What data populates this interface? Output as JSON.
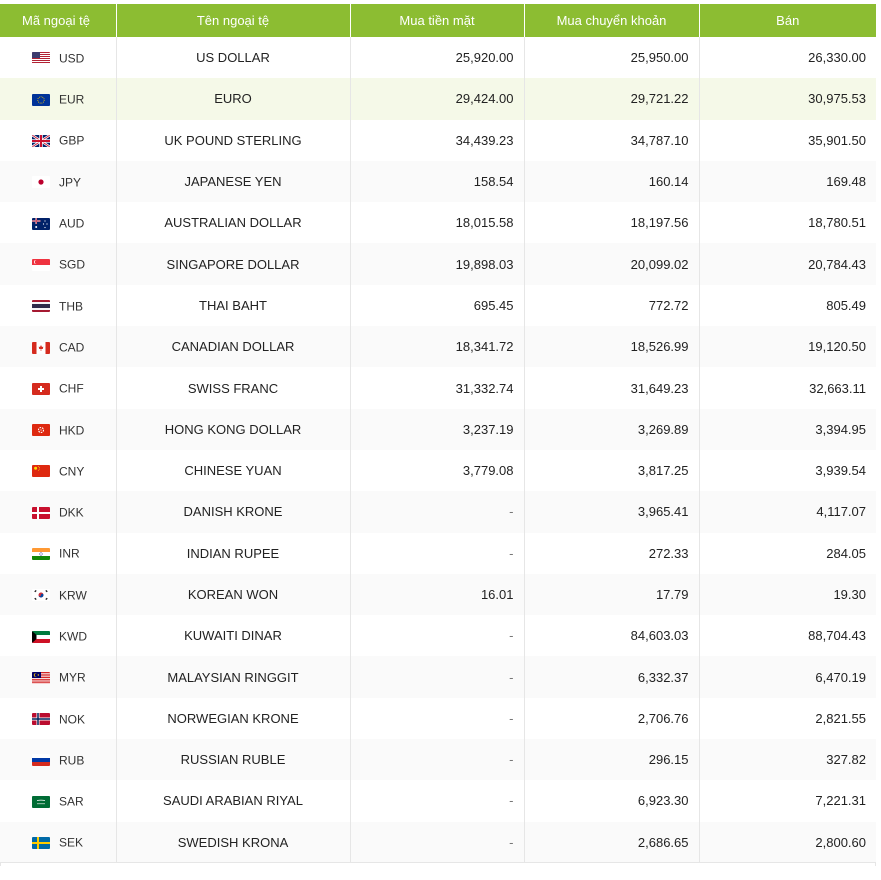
{
  "header": {
    "code": "Mã ngoại tệ",
    "name": "Tên ngoại tệ",
    "cash_buy": "Mua tiền mặt",
    "transfer_buy": "Mua chuyển khoản",
    "sell": "Bán"
  },
  "colors": {
    "header_bg": "#8cbd32",
    "highlight_row": "#f5f9e8"
  },
  "rows": [
    {
      "code": "USD",
      "name": "US DOLLAR",
      "cash": "25,920.00",
      "transfer": "25,950.00",
      "sell": "26,330.00",
      "flag": "us-flag-icon"
    },
    {
      "code": "EUR",
      "name": "EURO",
      "cash": "29,424.00",
      "transfer": "29,721.22",
      "sell": "30,975.53",
      "flag": "eu-flag-icon"
    },
    {
      "code": "GBP",
      "name": "UK POUND STERLING",
      "cash": "34,439.23",
      "transfer": "34,787.10",
      "sell": "35,901.50",
      "flag": "uk-flag-icon"
    },
    {
      "code": "JPY",
      "name": "JAPANESE YEN",
      "cash": "158.54",
      "transfer": "160.14",
      "sell": "169.48",
      "flag": "jp-flag-icon"
    },
    {
      "code": "AUD",
      "name": "AUSTRALIAN DOLLAR",
      "cash": "18,015.58",
      "transfer": "18,197.56",
      "sell": "18,780.51",
      "flag": "au-flag-icon"
    },
    {
      "code": "SGD",
      "name": "SINGAPORE DOLLAR",
      "cash": "19,898.03",
      "transfer": "20,099.02",
      "sell": "20,784.43",
      "flag": "sg-flag-icon"
    },
    {
      "code": "THB",
      "name": "THAI BAHT",
      "cash": "695.45",
      "transfer": "772.72",
      "sell": "805.49",
      "flag": "th-flag-icon"
    },
    {
      "code": "CAD",
      "name": "CANADIAN DOLLAR",
      "cash": "18,341.72",
      "transfer": "18,526.99",
      "sell": "19,120.50",
      "flag": "ca-flag-icon"
    },
    {
      "code": "CHF",
      "name": "SWISS FRANC",
      "cash": "31,332.74",
      "transfer": "31,649.23",
      "sell": "32,663.11",
      "flag": "ch-flag-icon"
    },
    {
      "code": "HKD",
      "name": "HONG KONG DOLLAR",
      "cash": "3,237.19",
      "transfer": "3,269.89",
      "sell": "3,394.95",
      "flag": "hk-flag-icon"
    },
    {
      "code": "CNY",
      "name": "CHINESE YUAN",
      "cash": "3,779.08",
      "transfer": "3,817.25",
      "sell": "3,939.54",
      "flag": "cn-flag-icon"
    },
    {
      "code": "DKK",
      "name": "DANISH KRONE",
      "cash": "-",
      "transfer": "3,965.41",
      "sell": "4,117.07",
      "flag": "dk-flag-icon"
    },
    {
      "code": "INR",
      "name": "INDIAN RUPEE",
      "cash": "-",
      "transfer": "272.33",
      "sell": "284.05",
      "flag": "in-flag-icon"
    },
    {
      "code": "KRW",
      "name": "KOREAN WON",
      "cash": "16.01",
      "transfer": "17.79",
      "sell": "19.30",
      "flag": "kr-flag-icon"
    },
    {
      "code": "KWD",
      "name": "KUWAITI DINAR",
      "cash": "-",
      "transfer": "84,603.03",
      "sell": "88,704.43",
      "flag": "kw-flag-icon"
    },
    {
      "code": "MYR",
      "name": "MALAYSIAN RINGGIT",
      "cash": "-",
      "transfer": "6,332.37",
      "sell": "6,470.19",
      "flag": "my-flag-icon"
    },
    {
      "code": "NOK",
      "name": "NORWEGIAN KRONE",
      "cash": "-",
      "transfer": "2,706.76",
      "sell": "2,821.55",
      "flag": "no-flag-icon"
    },
    {
      "code": "RUB",
      "name": "RUSSIAN RUBLE",
      "cash": "-",
      "transfer": "296.15",
      "sell": "327.82",
      "flag": "ru-flag-icon"
    },
    {
      "code": "SAR",
      "name": "SAUDI ARABIAN RIYAL",
      "cash": "-",
      "transfer": "6,923.30",
      "sell": "7,221.31",
      "flag": "sa-flag-icon"
    },
    {
      "code": "SEK",
      "name": "SWEDISH KRONA",
      "cash": "-",
      "transfer": "2,686.65",
      "sell": "2,800.60",
      "flag": "se-flag-icon"
    }
  ]
}
